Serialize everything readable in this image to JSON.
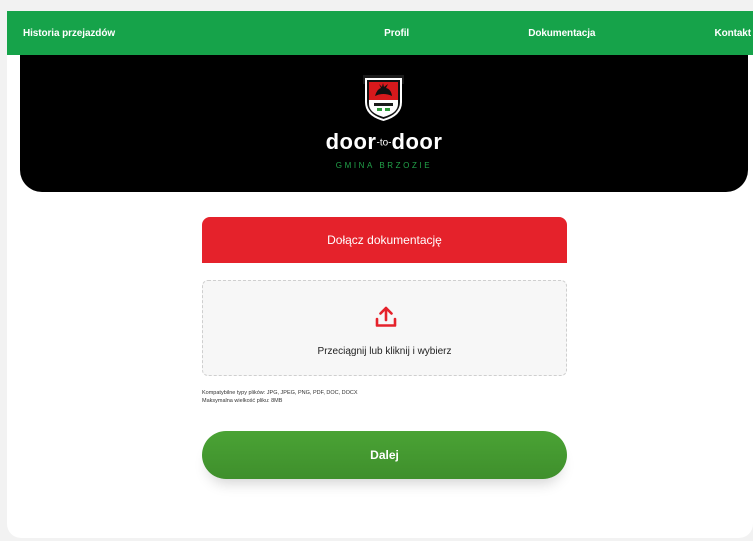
{
  "nav": {
    "items": [
      {
        "label": "Historia przejazdów"
      },
      {
        "label": "Profil"
      },
      {
        "label": "Dokumentacja"
      },
      {
        "label": "Kontakt"
      }
    ]
  },
  "hero": {
    "brand_left": "door",
    "brand_mid": "-to-",
    "brand_right": "door",
    "subtitle": "GMINA BRZOZIE"
  },
  "upload": {
    "title": "Dołącz dokumentację",
    "drop_text": "Przeciągnij lub kliknij i wybierz",
    "file_types": "Kompatybilne typy plików: JPG, JPEG, PNG, PDF, DOC, DOCX",
    "max_size": "Maksymalna wielkość pliku: 8MB"
  },
  "actions": {
    "next_label": "Dalej"
  },
  "colors": {
    "nav_green": "#16a34a",
    "header_red": "#e5222b",
    "button_green": "#4aa335",
    "subtitle_green": "#22a34a"
  },
  "icons": {
    "crest": "coat-of-arms-icon",
    "upload": "upload-icon"
  }
}
